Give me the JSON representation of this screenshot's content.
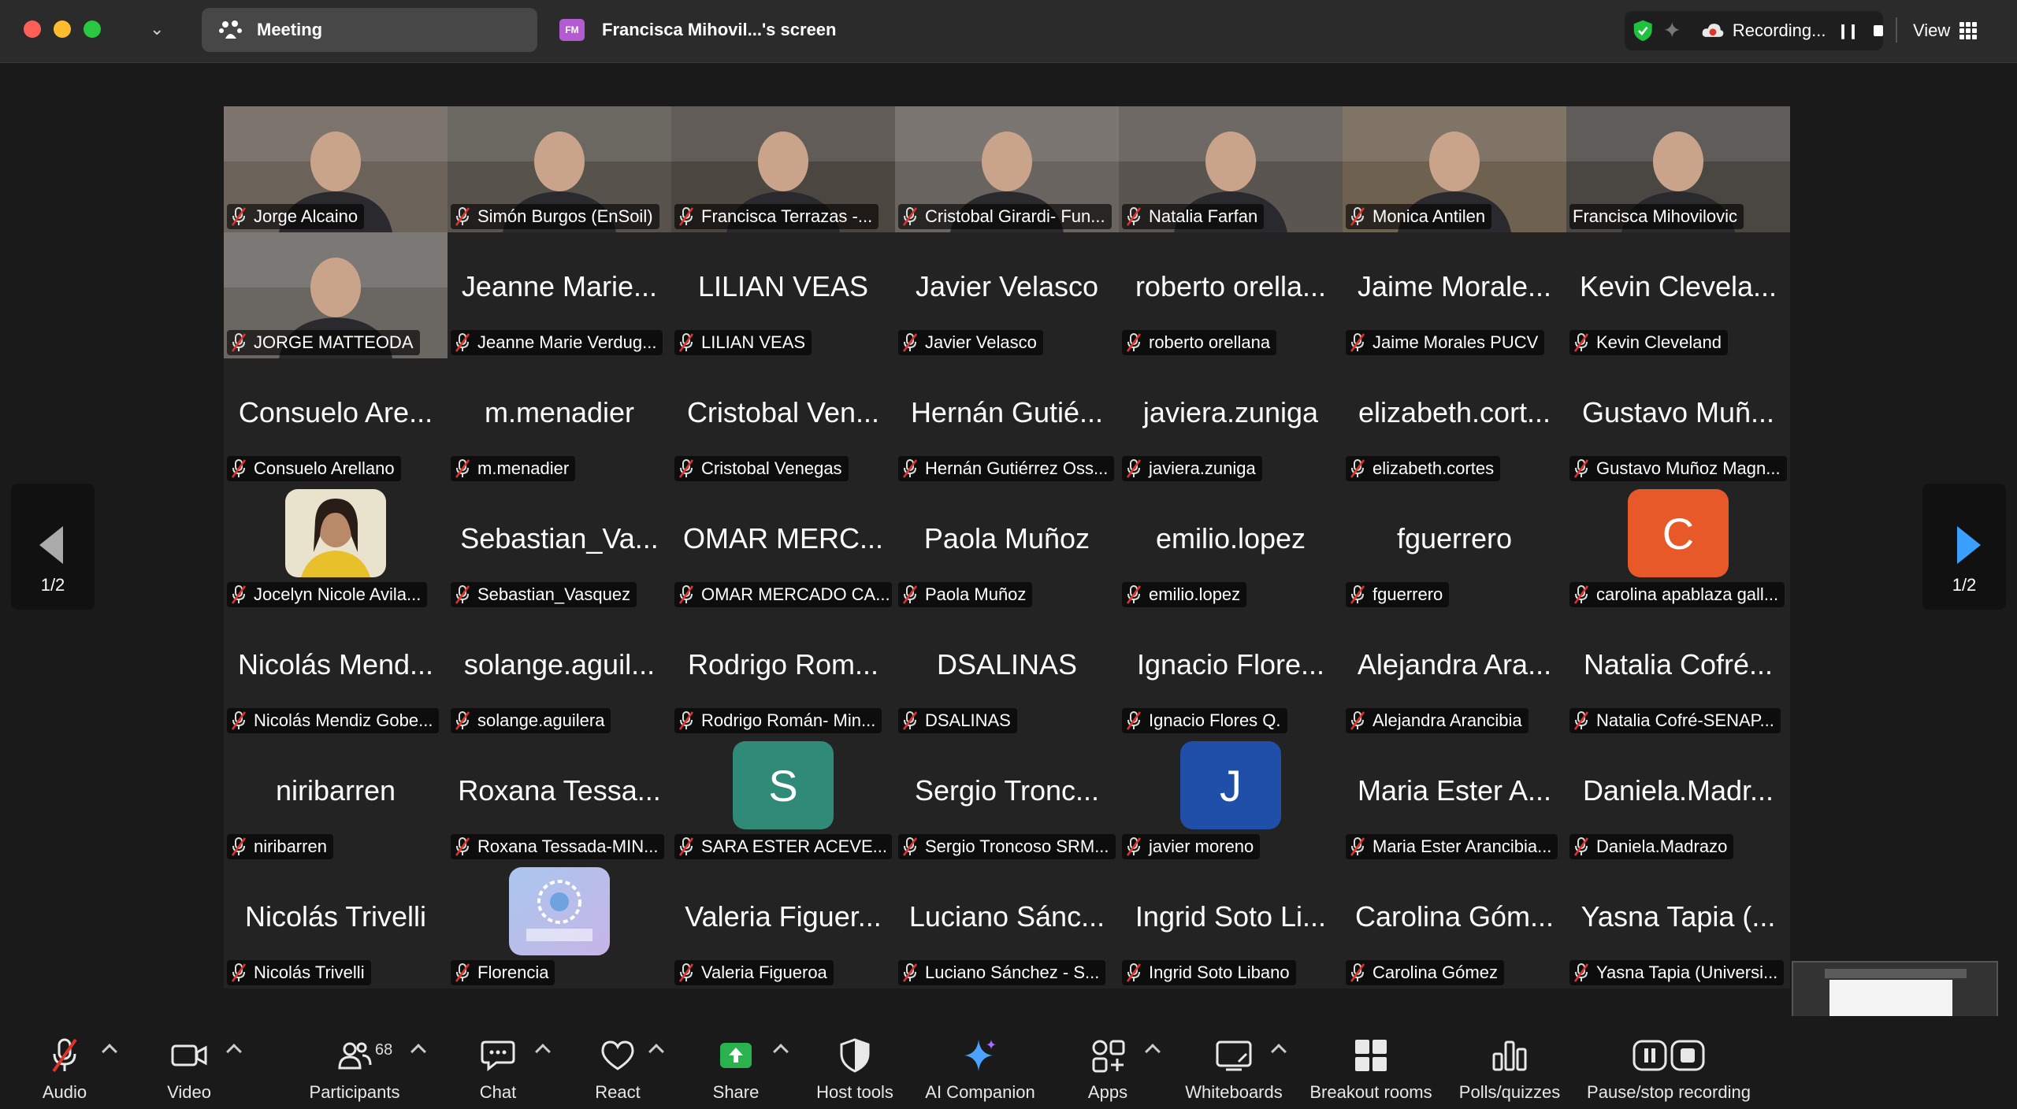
{
  "titlebar": {
    "meeting_tab": "Meeting",
    "screen_initials": "FM",
    "screen_tab": "Francisca Mihovil...'s screen",
    "recording_label": "Recording...",
    "view_label": "View"
  },
  "gallery": {
    "page_indicator_prev": "1/2",
    "page_indicator_next": "1/2",
    "rows": [
      [
        {
          "label": "Jorge Alcaino",
          "video": true
        },
        {
          "label": "Simón Burgos (EnSoil)",
          "video": true
        },
        {
          "label": "Francisca Terrazas -...",
          "video": true
        },
        {
          "label": "Cristobal Girardi- Fun...",
          "video": true
        },
        {
          "label": "Natalia Farfan",
          "video": true
        },
        {
          "label": "Monica Antilen",
          "video": true
        },
        {
          "label": "Francisca Mihovilovic",
          "video": true,
          "active": true
        }
      ],
      [
        {
          "label": "JORGE MATTEODA",
          "video": true
        },
        {
          "big": "Jeanne Marie...",
          "label": "Jeanne Marie Verdug..."
        },
        {
          "big": "LILIAN VEAS",
          "label": "LILIAN VEAS"
        },
        {
          "big": "Javier Velasco",
          "label": "Javier Velasco"
        },
        {
          "big": "roberto orella...",
          "label": "roberto orellana"
        },
        {
          "big": "Jaime Morale...",
          "label": "Jaime Morales PUCV"
        },
        {
          "big": "Kevin Clevela...",
          "label": "Kevin Cleveland"
        }
      ],
      [
        {
          "big": "Consuelo Are...",
          "label": "Consuelo Arellano"
        },
        {
          "big": "m.menadier",
          "label": "m.menadier"
        },
        {
          "big": "Cristobal Ven...",
          "label": "Cristobal Venegas"
        },
        {
          "big": "Hernán Gutié...",
          "label": "Hernán Gutiérrez Oss..."
        },
        {
          "big": "javiera.zuniga",
          "label": "javiera.zuniga"
        },
        {
          "big": "elizabeth.cort...",
          "label": "elizabeth.cortes"
        },
        {
          "big": "Gustavo Muñ...",
          "label": "Gustavo Muñoz Magn..."
        }
      ],
      [
        {
          "photo": true,
          "label": "Jocelyn Nicole Avila..."
        },
        {
          "big": "Sebastian_Va...",
          "label": "Sebastian_Vasquez"
        },
        {
          "big": "OMAR MERC...",
          "label": "OMAR MERCADO CA..."
        },
        {
          "big": "Paola Muñoz",
          "label": "Paola Muñoz"
        },
        {
          "big": "emilio.lopez",
          "label": "emilio.lopez"
        },
        {
          "big": "fguerrero",
          "label": "fguerrero"
        },
        {
          "letter": "C",
          "color": "#e8592a",
          "label": "carolina apablaza gall..."
        }
      ],
      [
        {
          "big": "Nicolás Mend...",
          "label": "Nicolás Mendiz Gobe..."
        },
        {
          "big": "solange.aguil...",
          "label": "solange.aguilera"
        },
        {
          "big": "Rodrigo Rom...",
          "label": "Rodrigo Román- Min..."
        },
        {
          "big": "DSALINAS",
          "label": "DSALINAS"
        },
        {
          "big": "Ignacio Flore...",
          "label": "Ignacio Flores Q."
        },
        {
          "big": "Alejandra Ara...",
          "label": "Alejandra Arancibia"
        },
        {
          "big": "Natalia Cofré...",
          "label": "Natalia Cofré-SENAP..."
        }
      ],
      [
        {
          "big": "niribarren",
          "label": "niribarren"
        },
        {
          "big": "Roxana Tessa...",
          "label": "Roxana Tessada-MIN..."
        },
        {
          "letter": "S",
          "color": "#2f8a78",
          "label": "SARA ESTER ACEVE..."
        },
        {
          "big": "Sergio Tronc...",
          "label": "Sergio Troncoso SRM..."
        },
        {
          "letter": "J",
          "color": "#1f4fa8",
          "label": "javier moreno"
        },
        {
          "big": "Maria Ester A...",
          "label": "Maria Ester Arancibia..."
        },
        {
          "big": "Daniela.Madr...",
          "label": "Daniela.Madrazo"
        }
      ],
      [
        {
          "big": "Nicolás Trivelli",
          "label": "Nicolás Trivelli"
        },
        {
          "logo": true,
          "label": "Florencia"
        },
        {
          "big": "Valeria Figuer...",
          "label": "Valeria Figueroa"
        },
        {
          "big": "Luciano Sánc...",
          "label": "Luciano Sánchez - S..."
        },
        {
          "big": "Ingrid Soto Li...",
          "label": "Ingrid Soto Libano"
        },
        {
          "big": "Carolina Góm...",
          "label": "Carolina Gómez"
        },
        {
          "big": "Yasna Tapia (...",
          "label": "Yasna Tapia (Universi..."
        }
      ]
    ]
  },
  "toolbar": {
    "audio": "Audio",
    "video": "Video",
    "participants": "Participants",
    "participants_count": "68",
    "chat": "Chat",
    "react": "React",
    "share": "Share",
    "host_tools": "Host tools",
    "ai_companion": "AI Companion",
    "apps": "Apps",
    "whiteboards": "Whiteboards",
    "breakout_rooms": "Breakout rooms",
    "polls": "Polls/quizzes",
    "pause_stop": "Pause/stop recording"
  },
  "colors": {
    "accent_active": "#36c04a",
    "share_green": "#29b24d",
    "nav_next": "#3aa0ff",
    "muted_red": "#e0342b"
  }
}
